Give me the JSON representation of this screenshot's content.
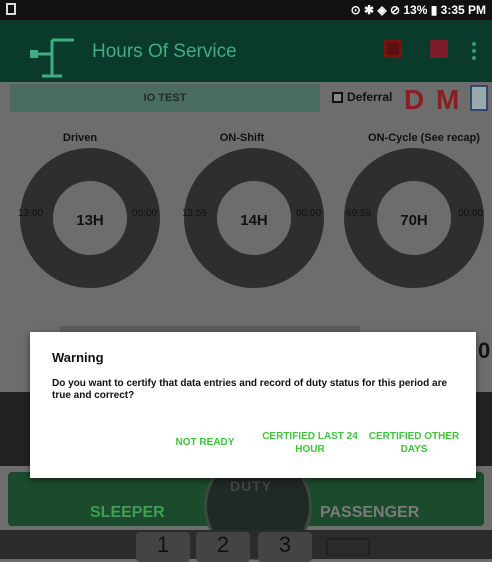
{
  "status_bar": {
    "text": "⊙ ✱ ◈ ⊘ 13% ▮ 3:35 PM"
  },
  "app_bar": {
    "title": "Hours Of Service",
    "icons": [
      "logo-icon",
      "alert-icon",
      "message-icon",
      "more-vert-icon"
    ]
  },
  "driver": {
    "name": "IO TEST"
  },
  "deferral": {
    "label": "Deferral",
    "checked": false
  },
  "dm_label": "D M",
  "gauges": [
    {
      "title": "Driven",
      "center": "13H",
      "left": "13:00",
      "right": "00:00"
    },
    {
      "title": "ON-Shift",
      "center": "14H",
      "left": "13:59",
      "right": "00:00"
    },
    {
      "title": "ON-Cycle (See recap)",
      "center": "70H",
      "left": "69:59",
      "right": "00:00"
    }
  ],
  "side_number": "0",
  "bottom_buttons": {
    "sleeper": "SLEEPER",
    "passenger": "PASSENGER",
    "duty": "DUTY"
  },
  "keypad": {
    "keys": [
      "1",
      "2",
      "3"
    ]
  },
  "dialog": {
    "title": "Warning",
    "message": "Do you want to certify that data entries and record of duty status for this period are true and correct?",
    "buttons": {
      "not_ready": "NOT READY",
      "certified_24": "CERTIFIED LAST 24 HOUR",
      "certified_other": "CERTIFIED OTHER DAYS"
    },
    "button_color": "#3fc43c"
  },
  "colors": {
    "app_bar": "#0a3a2c",
    "accent": "#3fae83",
    "dm": "#8a1f1f"
  }
}
